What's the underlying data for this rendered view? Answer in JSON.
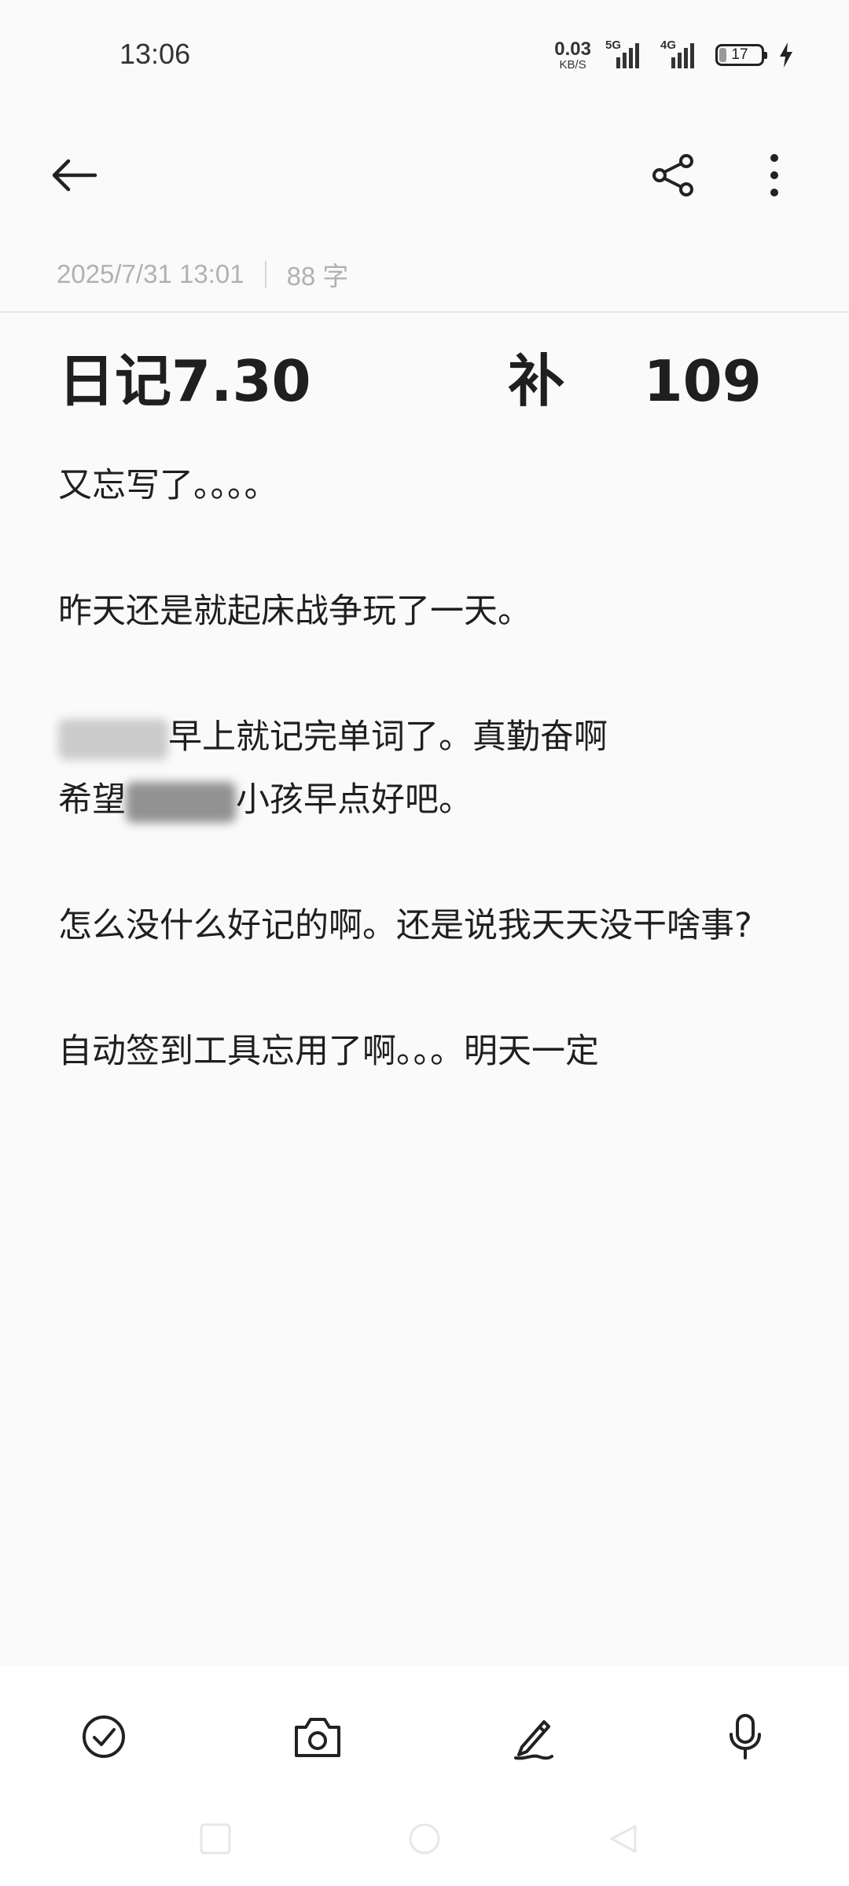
{
  "status_bar": {
    "time": "13:06",
    "net_speed_value": "0.03",
    "net_speed_unit": "KB/S",
    "signal_1_tag": "5G",
    "signal_2_tag": "4G",
    "battery_level": "17"
  },
  "toolbar": {
    "back_icon": "back-arrow-icon",
    "share_icon": "share-icon",
    "more_icon": "more-vertical-icon"
  },
  "meta": {
    "date": "2025/7/31 13:01",
    "word_count": "88 字"
  },
  "note": {
    "title": "日记7.30          补    109",
    "paragraphs": [
      "又忘写了。。。。",
      "",
      "昨天还是就起床战争玩了一天。",
      "",
      "早上就记完单词了。真勤奋啊",
      "希望",
      "小孩早点好吧。",
      "",
      "怎么没什么好记的啊。还是说我天天没干啥事?",
      "",
      "自动签到工具忘用了啊。。。明天一定"
    ]
  },
  "bottom_toolbar": {
    "checklist_icon": "checklist-icon",
    "camera_icon": "camera-icon",
    "handwriting_icon": "handwriting-pen-icon",
    "voice_icon": "microphone-icon"
  },
  "navigation": {
    "recent_icon": "recent-apps-icon",
    "home_icon": "home-icon",
    "back_icon": "nav-back-icon"
  }
}
